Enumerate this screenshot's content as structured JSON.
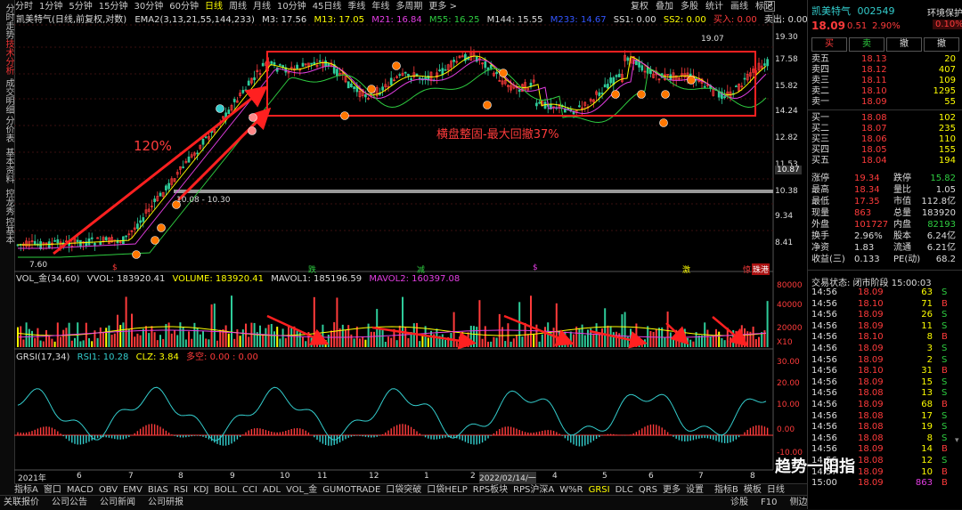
{
  "left_tabs": [
    {
      "label": "分时走势",
      "active": false
    },
    {
      "label": "技术分析",
      "active": true
    },
    {
      "label": "成交明细",
      "active": false
    },
    {
      "label": "分价表",
      "active": false
    },
    {
      "label": "基本资料",
      "active": false
    },
    {
      "label": "控龙秀",
      "active": false
    },
    {
      "label": "控基本",
      "active": false
    }
  ],
  "periods": [
    "分时",
    "1分钟",
    "5分钟",
    "15分钟",
    "30分钟",
    "60分钟",
    "日线",
    "周线",
    "月线",
    "10分钟",
    "45日线",
    "季线",
    "年线",
    "多周期",
    "更多 >"
  ],
  "active_period": "日线",
  "right_tools": [
    "复权",
    "叠加",
    "多股",
    "统计",
    "画线",
    "标记"
  ],
  "main": {
    "title": "凯美特气(日线,前复权,对数)",
    "ema_label": "EMA2(3,13,21,55,144,233)",
    "m3": "M3: 17.56",
    "m13": "M13: 17.05",
    "m21": "M21: 16.84",
    "m55": "M55: 16.25",
    "m144": "M144: 15.55",
    "m233": "M233: 14.67",
    "ss1": "SS1: 0.00",
    "ss2": "SS2: 0.00",
    "buy": "买入: 0.00",
    "sell": "卖出: 0.00",
    "price_axis": [
      "19.30",
      "17.58",
      "15.82",
      "14.24",
      "12.82",
      "11.53",
      "10.38",
      "9.34",
      "8.41"
    ],
    "current_price_tag": "10.87",
    "high_label": "19.07",
    "low_label": "7.60",
    "range_label": "10.08 - 10.30",
    "gain_label": "120%",
    "consolidation_label": "横盘整固-最大回撤37%",
    "event_labels": [
      "$",
      "跌",
      "减",
      "$",
      "激",
      "惊",
      "珠港"
    ]
  },
  "volume": {
    "label": "VOL_金(34,60)",
    "vvol": "VVOL: 183920.41",
    "volume": "VOLUME: 183920.41",
    "mavol1": "MAVOL1: 185196.59",
    "mavol2": "MAVOL2: 160397.08",
    "axis": [
      "80000",
      "40000",
      "20000",
      "X10"
    ]
  },
  "grsi": {
    "label": "GRSI(17,34)",
    "rsi1": "RSI1: 10.28",
    "clz": "CLZ: 3.84",
    "dk": "多空: 0.00 : 0.00",
    "axis": [
      "30.00",
      "20.00",
      "10.00",
      "0.00",
      "-10.00"
    ]
  },
  "time_axis": [
    "2021年",
    "6",
    "7",
    "8",
    "9",
    "10",
    "11",
    "12",
    "1",
    "2",
    "2022/02/14/一",
    "4",
    "5",
    "6",
    "7",
    "8"
  ],
  "indicators": [
    "指标A",
    "窗口",
    "MACD",
    "OBV",
    "EMV",
    "BIAS",
    "RSI",
    "KDJ",
    "BOLL",
    "CCI",
    "ADL",
    "VOL_金",
    "GUMOTRADE",
    "口袋突破",
    "口袋HELP",
    "RPS板块",
    "RPS沪深A",
    "W%R",
    "GRSI",
    "DLC",
    "QRS",
    "更多",
    "设置"
  ],
  "active_indicator": "GRSI",
  "bottom_right": [
    "指标B",
    "模板",
    "日线"
  ],
  "status": [
    "关联报价",
    "公司公告",
    "公司新闻",
    "公司研报"
  ],
  "status_right": [
    "诊股",
    "F10",
    "侧边 <"
  ],
  "quote": {
    "name": "凯美特气",
    "code": "002549",
    "protect": "环境保护",
    "price": "18.09",
    "change": "0.51",
    "pct": "2.90%",
    "rank": "0.10%",
    "buttons": [
      "买",
      "卖",
      "撤",
      "撤"
    ],
    "sells": [
      [
        "卖五",
        "18.13",
        "20"
      ],
      [
        "卖四",
        "18.12",
        "407"
      ],
      [
        "卖三",
        "18.11",
        "109"
      ],
      [
        "卖二",
        "18.10",
        "1295"
      ],
      [
        "卖一",
        "18.09",
        "55"
      ]
    ],
    "buys": [
      [
        "买一",
        "18.08",
        "102"
      ],
      [
        "买二",
        "18.07",
        "235"
      ],
      [
        "买三",
        "18.06",
        "110"
      ],
      [
        "买四",
        "18.05",
        "155"
      ],
      [
        "买五",
        "18.04",
        "194"
      ]
    ],
    "stats": [
      [
        "涨停",
        "19.34",
        "跌停",
        "15.82"
      ],
      [
        "最高",
        "18.34",
        "量比",
        "1.05"
      ],
      [
        "最低",
        "17.35",
        "市值",
        "112.8亿"
      ],
      [
        "现量",
        "863",
        "总量",
        "183920"
      ],
      [
        "外盘",
        "101727",
        "内盘",
        "82193"
      ],
      [
        "换手",
        "2.96%",
        "股本",
        "6.24亿"
      ],
      [
        "净资",
        "1.83",
        "流通",
        "6.21亿"
      ],
      [
        "收益(三)",
        "0.133",
        "PE(动)",
        "68.2"
      ]
    ],
    "trade_status": "交易状态: 闭市阶段 15:00:03",
    "ticks": [
      [
        "14:56",
        "18.09",
        "63",
        "S"
      ],
      [
        "14:56",
        "18.10",
        "71",
        "B"
      ],
      [
        "14:56",
        "18.09",
        "26",
        "S"
      ],
      [
        "14:56",
        "18.09",
        "11",
        "S"
      ],
      [
        "14:56",
        "18.10",
        "8",
        "B"
      ],
      [
        "14:56",
        "18.09",
        "3",
        "S"
      ],
      [
        "14:56",
        "18.09",
        "2",
        "S"
      ],
      [
        "14:56",
        "18.10",
        "31",
        "B"
      ],
      [
        "14:56",
        "18.09",
        "15",
        "S"
      ],
      [
        "14:56",
        "18.08",
        "13",
        "S"
      ],
      [
        "14:56",
        "18.09",
        "68",
        "B"
      ],
      [
        "14:56",
        "18.08",
        "17",
        "S"
      ],
      [
        "14:56",
        "18.08",
        "19",
        "S"
      ],
      [
        "14:56",
        "18.08",
        "8",
        "S"
      ],
      [
        "14:56",
        "18.09",
        "14",
        "B"
      ],
      [
        "14:56",
        "18.08",
        "12",
        "S"
      ],
      [
        "14:57",
        "18.09",
        "10",
        "B"
      ],
      [
        "15:00",
        "18.09",
        "863",
        "B"
      ]
    ]
  },
  "watermark": "趋势一阳指",
  "colors": {
    "up": "#ff3b3b",
    "down": "#2ecc40",
    "bg": "#000000",
    "yellow": "#ffff00",
    "magenta": "#e33ee3",
    "cyan": "#33cccc"
  }
}
